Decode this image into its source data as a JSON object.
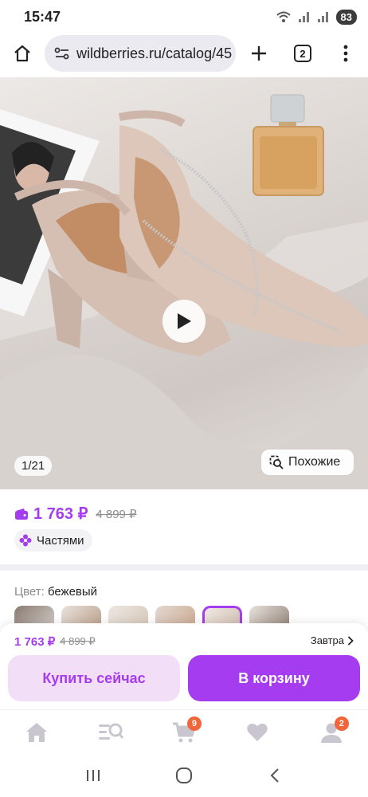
{
  "status_bar": {
    "time": "15:47",
    "battery": "83"
  },
  "browser": {
    "url": "wildberries.ru/catalog/45",
    "tab_count": "2"
  },
  "gallery": {
    "counter": "1/21",
    "similar_label": "Похожие"
  },
  "price": {
    "current": "1 763 ₽",
    "old": "4 899 ₽",
    "installments_label": "Частями"
  },
  "color": {
    "label": "Цвет:",
    "value": "бежевый",
    "swatch_count": 6,
    "selected_index": 4
  },
  "buy_panel": {
    "price": "1 763 ₽",
    "old_price": "4 899 ₽",
    "delivery": "Завтра",
    "buy_now_label": "Купить сейчас",
    "add_to_cart_label": "В корзину"
  },
  "bottom_nav": {
    "items": [
      {
        "name": "home",
        "badge": ""
      },
      {
        "name": "catalog",
        "badge": ""
      },
      {
        "name": "cart",
        "badge": "9"
      },
      {
        "name": "favorites",
        "badge": ""
      },
      {
        "name": "profile",
        "badge": "2"
      }
    ]
  },
  "colors": {
    "accent": "#a63cf0",
    "accent_light": "#f3def8",
    "badge": "#f0653a",
    "nav_icon": "#c9c6d0"
  }
}
